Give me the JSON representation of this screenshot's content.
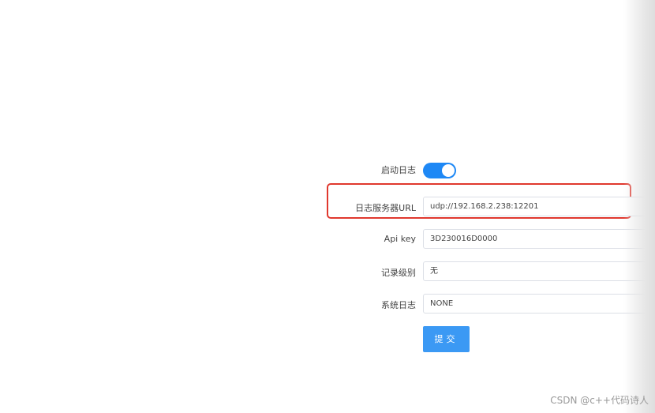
{
  "form": {
    "enable_log": {
      "label": "启动日志",
      "on": true
    },
    "log_server_url": {
      "label": "日志服务器URL",
      "value": "udp://192.168.2.238:12201"
    },
    "api_key": {
      "label": "Api key",
      "value": "3D230016D0000"
    },
    "record_level": {
      "label": "记录级别",
      "value": "无"
    },
    "system_log": {
      "label": "系统日志",
      "value": "NONE"
    },
    "submit_label": "提交"
  },
  "watermark": "CSDN @c++代码诗人",
  "colors": {
    "accent": "#1e88f5",
    "highlight": "#e0382e",
    "button": "#3b99f4"
  }
}
